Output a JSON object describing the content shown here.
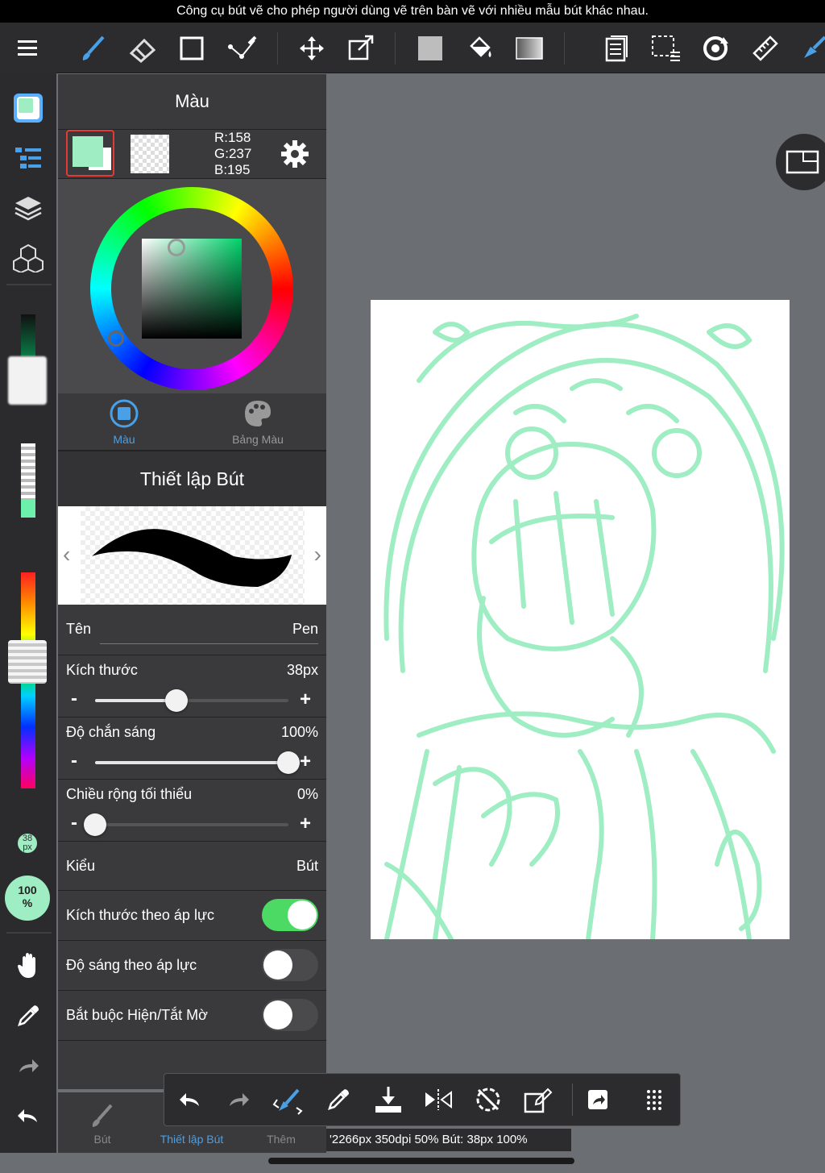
{
  "caption": "Công cụ bút vẽ cho phép người dùng vẽ trên bàn vẽ với nhiều mẫu bút khác nhau.",
  "toolbar": {
    "icons": [
      "menu-icon",
      "brush-icon",
      "eraser-icon",
      "rectangle-icon",
      "pen-path-icon",
      "move-icon",
      "transform-icon",
      "fill-color-icon",
      "bucket-icon",
      "gradient-icon",
      "layers-doc-icon",
      "selection-icon",
      "rotate-icon",
      "ruler-icon",
      "pen-nib-icon"
    ]
  },
  "color_panel": {
    "title": "Màu",
    "rgb": {
      "r": "R:158",
      "g": "G:237",
      "b": "B:195"
    },
    "primary_color": "#9eedc3",
    "tabs": [
      {
        "label": "Màu"
      },
      {
        "label": "Bảng Màu"
      }
    ]
  },
  "pen_settings": {
    "title": "Thiết lập Bút",
    "name_label": "Tên",
    "name_value": "Pen",
    "size_label": "Kích thước",
    "size_value": "38px",
    "size_fraction": 0.42,
    "opacity_label": "Độ chắn sáng",
    "opacity_value": "100%",
    "opacity_fraction": 1.0,
    "min_width_label": "Chiều rộng tối thiểu",
    "min_width_value": "0%",
    "min_width_fraction": 0.0,
    "type_label": "Kiểu",
    "type_value": "Bút",
    "pressure_size_label": "Kích thước theo áp lực",
    "pressure_size_on": true,
    "pressure_opacity_label": "Độ sáng theo áp lực",
    "pressure_opacity_on": false,
    "force_fade_label": "Bắt buộc Hiện/Tắt Mờ",
    "force_fade_on": false
  },
  "leftbar": {
    "size_badge": "38 px",
    "opacity_badge_line1": "100",
    "opacity_badge_line2": "%"
  },
  "bottom_tabs": [
    {
      "label": "Bút"
    },
    {
      "label": "Thiết lập Bút"
    },
    {
      "label": "Thêm"
    }
  ],
  "status_text": "'2266px 350dpi 50% Bút: 38px 100%",
  "colors": {
    "accent": "#4aa0e6",
    "toggle_on": "#4cd964",
    "stroke": "#9eedc3"
  }
}
